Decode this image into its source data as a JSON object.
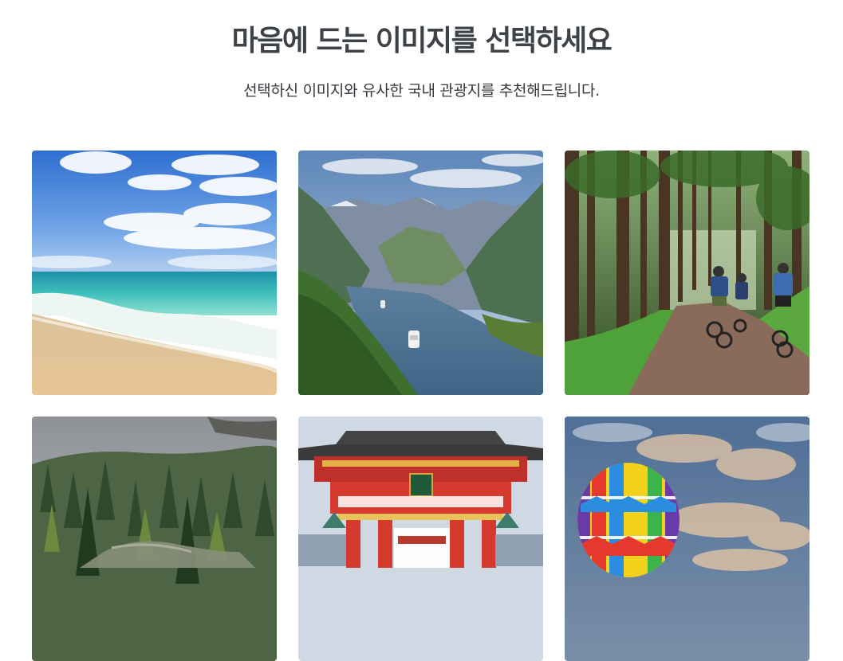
{
  "header": {
    "title": "마음에 드는 이미지를 선택하세요",
    "subtitle": "선택하신 이미지와 유사한 국내 관광지를 추천해드립니다."
  },
  "images": [
    {
      "subject": "beach"
    },
    {
      "subject": "fjord"
    },
    {
      "subject": "forest-cycling"
    },
    {
      "subject": "misty-forest"
    },
    {
      "subject": "red-temple-gate"
    },
    {
      "subject": "hot-air-balloon"
    }
  ]
}
